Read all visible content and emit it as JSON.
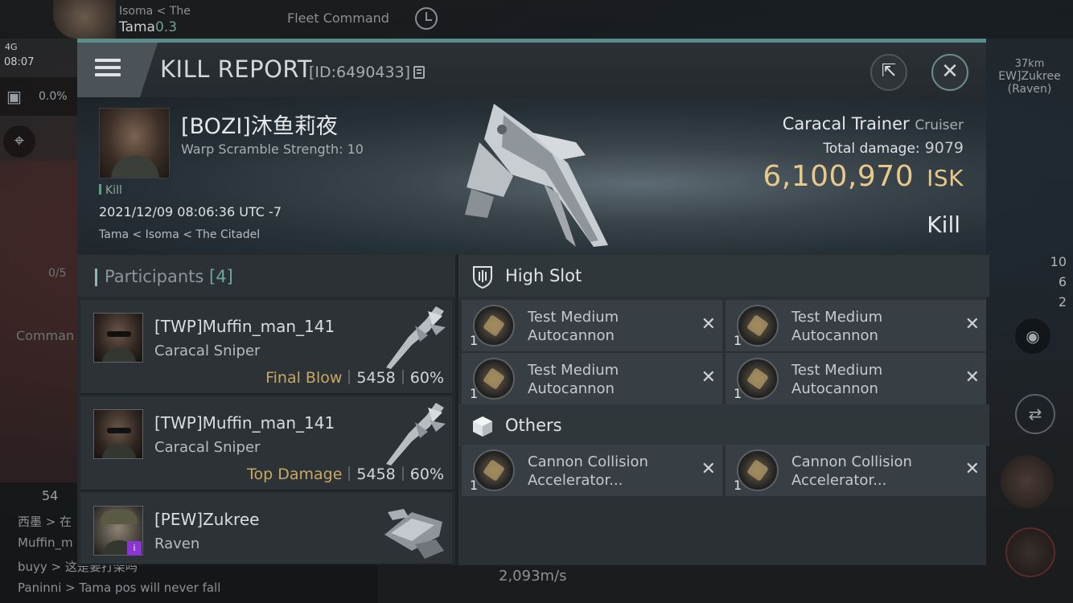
{
  "hud": {
    "pilot_location_a": "Isoma",
    "pilot_location_a2": "< The",
    "pilot_location_b": "Tama",
    "security": "0.3",
    "fleet_command": "Fleet Command",
    "network": "4G",
    "time": "08:07",
    "cargo_pct": "0.0%",
    "left_count": "0/5",
    "left_label": "Comman",
    "chat_count": "54",
    "chat_lines": [
      "西墨 > 在",
      "Muffin_m",
      "buyy > 这是要打架吗",
      "Paninni > Tama pos will never fall"
    ],
    "speed": "2,093m/s",
    "target_distance": "37km",
    "target_name": "EW]Zukree",
    "target_ship": "(Raven)",
    "counters": [
      "10",
      "6",
      "2"
    ]
  },
  "report": {
    "title": "KILL REPORT",
    "id_text": "[ID:6490433]",
    "victim": {
      "name": "[BOZI]沐鱼莉夜",
      "warp_scramble": "Warp Scramble Strength: 10",
      "kill_label": "Kill",
      "date": "2021/12/09 08:06:36 UTC -7",
      "location": "Tama < Isoma < The Citadel"
    },
    "ship": {
      "name": "Caracal Trainer",
      "class": "Cruiser",
      "total_damage_label": "Total damage:",
      "total_damage": "9079",
      "isk_value": "6,100,970",
      "isk_unit": "ISK",
      "result": "Kill"
    },
    "participants": {
      "label": "Participants",
      "count": "[4]",
      "items": [
        {
          "name": "[TWP]Muffin_man_141",
          "ship": "Caracal Sniper",
          "role": "Final Blow",
          "damage": "5458",
          "percent": "60%"
        },
        {
          "name": "[TWP]Muffin_man_141",
          "ship": "Caracal Sniper",
          "role": "Top Damage",
          "damage": "5458",
          "percent": "60%"
        },
        {
          "name": "[PEW]Zukree",
          "ship": "Raven",
          "role": "",
          "damage": "",
          "percent": ""
        }
      ]
    },
    "high_slot": {
      "label": "High Slot",
      "modules": [
        {
          "qty": "1",
          "name": "Test Medium Autocannon"
        },
        {
          "qty": "1",
          "name": "Test Medium Autocannon"
        },
        {
          "qty": "1",
          "name": "Test Medium Autocannon"
        },
        {
          "qty": "1",
          "name": "Test Medium Autocannon"
        }
      ]
    },
    "others": {
      "label": "Others",
      "modules": [
        {
          "qty": "1",
          "name": "Cannon Collision Accelerator..."
        },
        {
          "qty": "1",
          "name": "Cannon Collision Accelerator..."
        }
      ]
    }
  },
  "colors": {
    "accent": "#5b8c88",
    "isk": "#e9c98a",
    "role": "#c8a964",
    "badge": "#8a35d6"
  }
}
